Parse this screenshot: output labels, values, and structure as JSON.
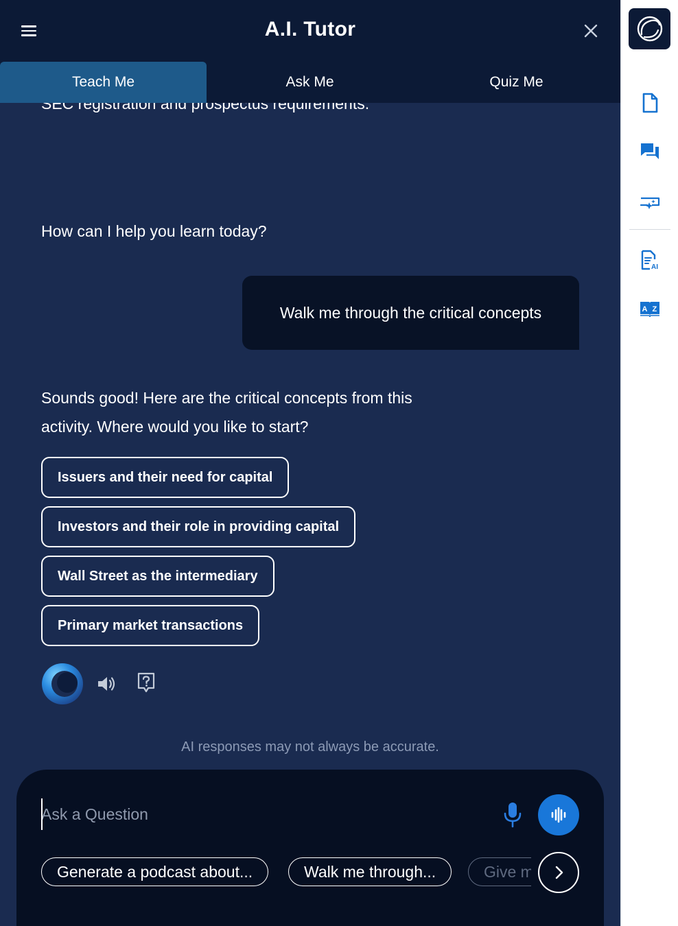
{
  "header": {
    "title": "A.I. Tutor"
  },
  "tabs": [
    {
      "label": "Teach Me",
      "active": true
    },
    {
      "label": "Ask Me",
      "active": false
    },
    {
      "label": "Quiz Me",
      "active": false
    }
  ],
  "chat": {
    "cut_text": "SEC registration and prospectus requirements.",
    "greeting": "How can I help you learn today?",
    "user_message": "Walk me through the critical concepts",
    "reply_line1": "Sounds good! Here are the critical concepts from this",
    "reply_line2": "activity. Where would you like to start?",
    "options": [
      "Issuers and their need for capital",
      "Investors and their role in providing capital",
      "Wall Street as the intermediary",
      "Primary market transactions"
    ],
    "disclaimer": "AI responses may not always be accurate."
  },
  "composer": {
    "placeholder": "Ask a Question",
    "suggestions": [
      "Generate a podcast about...",
      "Walk me through...",
      "Give m"
    ]
  },
  "colors": {
    "panel_bg": "#1a2b50",
    "header_bg": "#0c1a36",
    "active_tab": "#1e5a8a",
    "accent_blue": "#1977d9",
    "rail_icon": "#1572d0"
  },
  "icons": {
    "menu": "hamburger-icon",
    "close": "close-icon",
    "rail": [
      "document-icon",
      "chat-icon",
      "screen-sparkle-icon",
      "ai-document-icon",
      "glossary-icon"
    ],
    "actions": [
      "speaker-icon",
      "help-icon"
    ],
    "composer": [
      "microphone-icon",
      "voice-wave-icon",
      "chevron-right-icon"
    ]
  }
}
